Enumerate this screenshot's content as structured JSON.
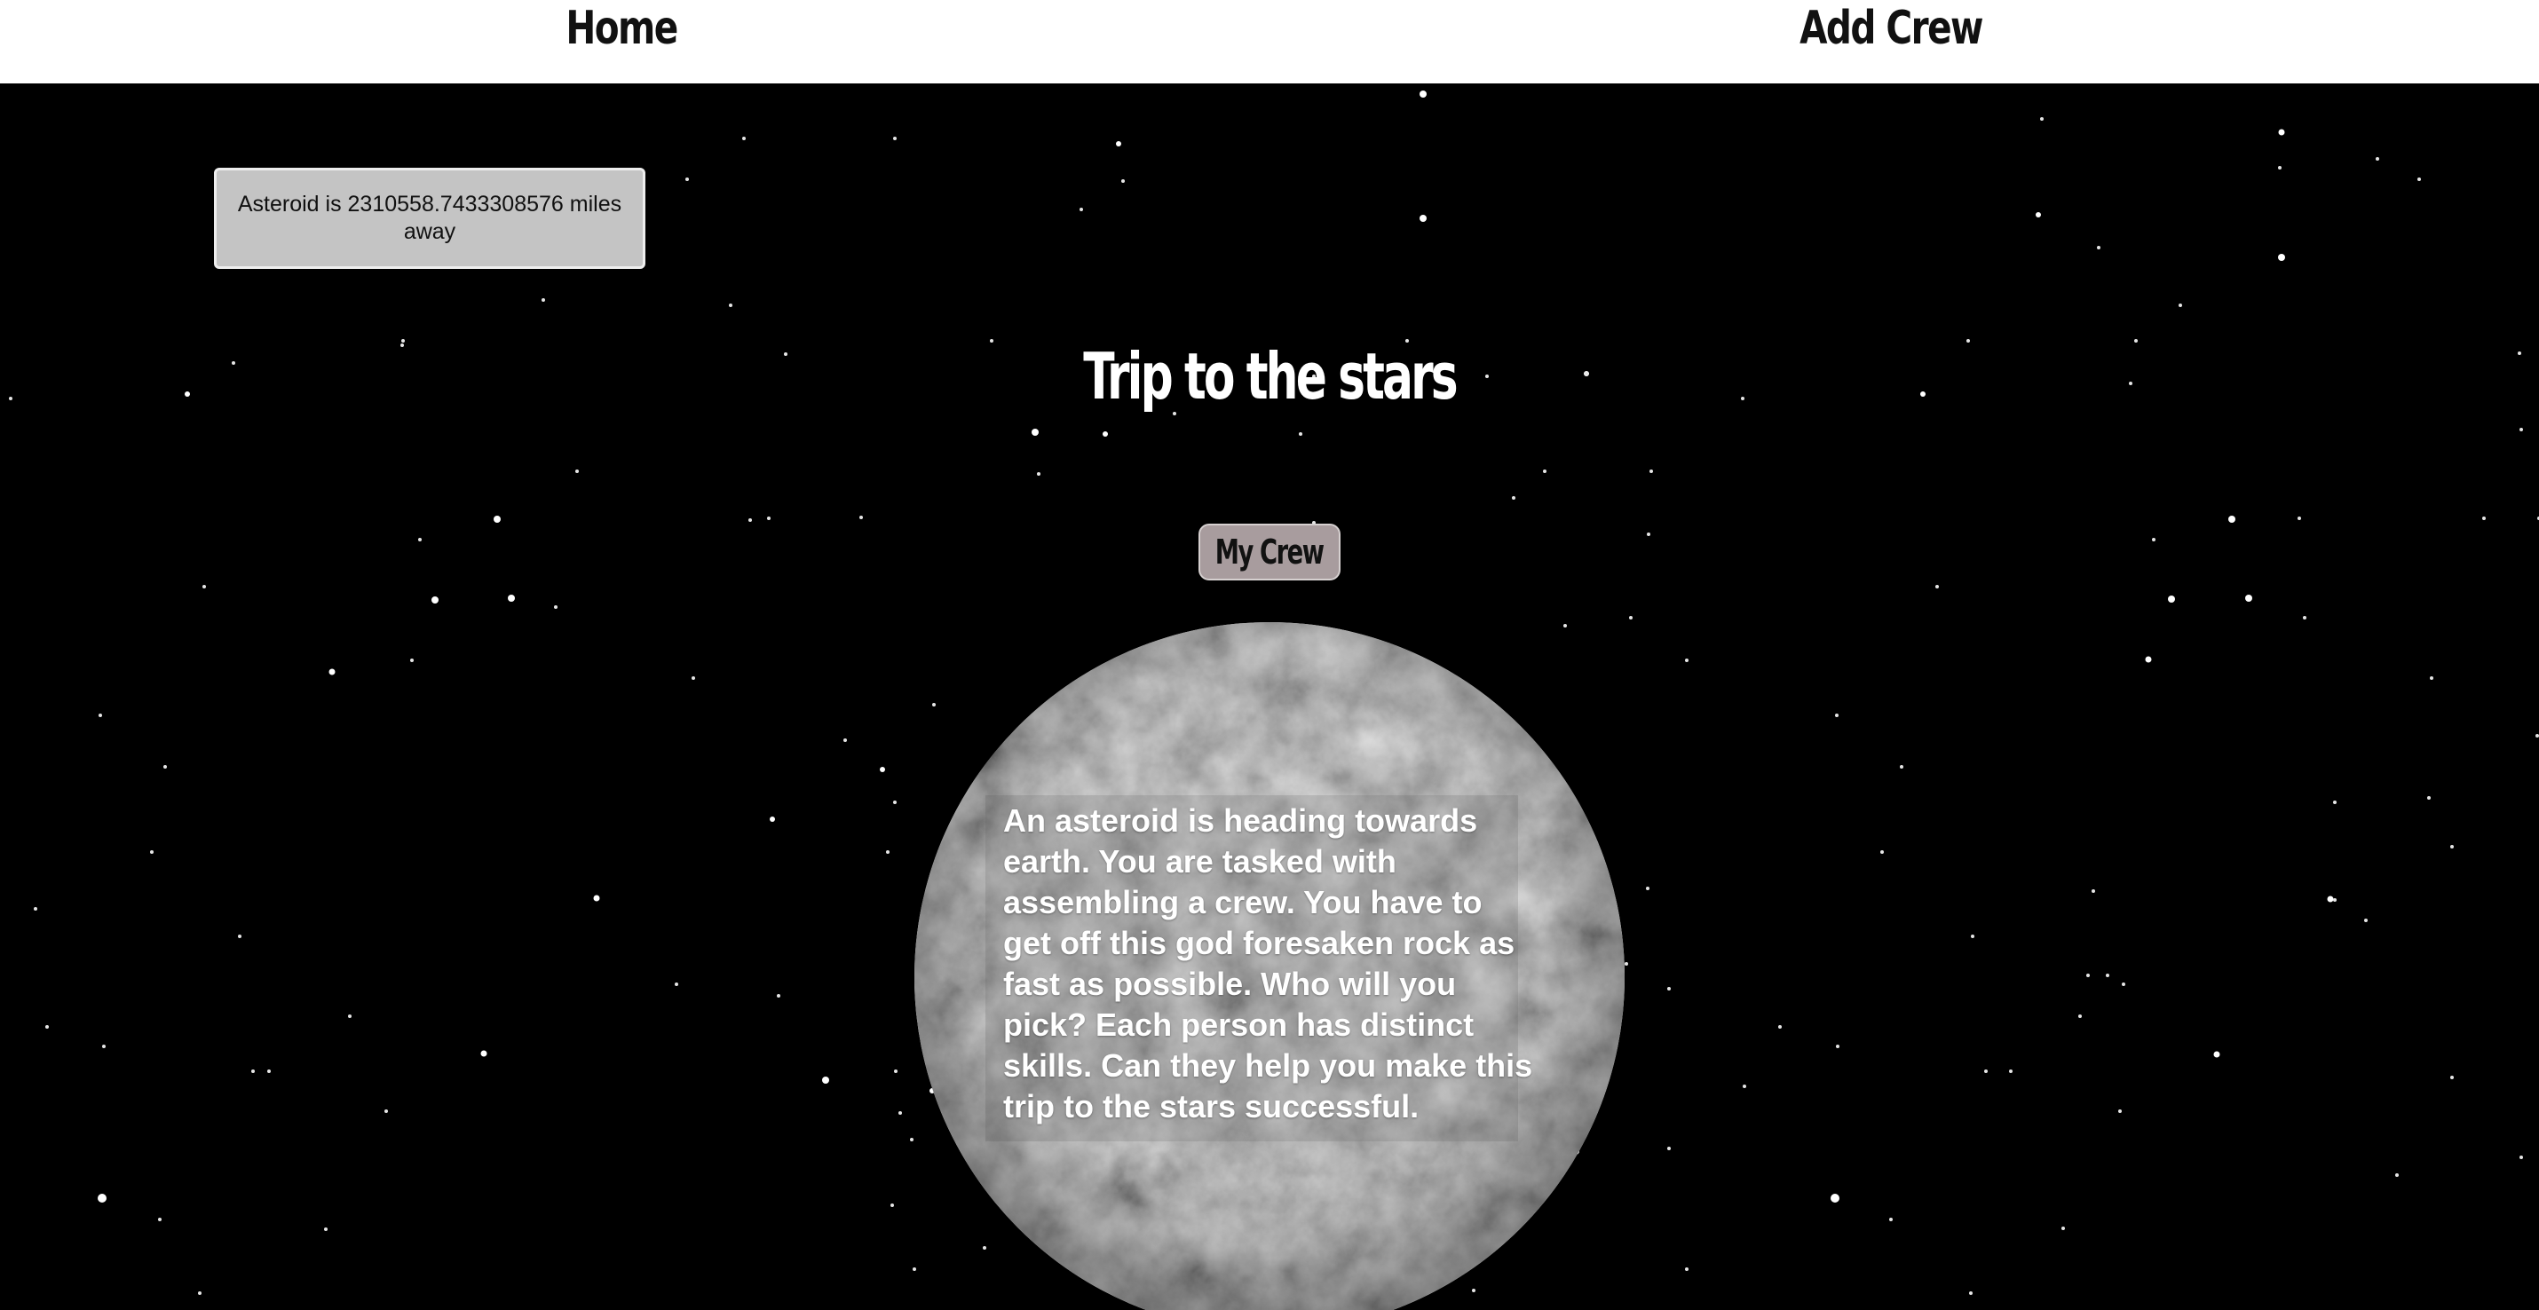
{
  "nav": {
    "home_label": "Home",
    "add_crew_label": "Add Crew"
  },
  "distance": {
    "text": "Asteroid is 2310558.7433308576 miles away"
  },
  "page": {
    "title": "Trip to the stars"
  },
  "crew_button": {
    "label": "My Crew"
  },
  "story": {
    "text": "An asteroid is heading towards earth. You are tasked with assembling a crew. You have to get off this god foresaken rock as fast as possible. Who will you pick? Each person has distinct skills. Can they help you make this trip to the stars successful."
  },
  "colors": {
    "nav_background": "#ffffff",
    "space_background": "#000000",
    "distance_box": "#c4c4c4",
    "crew_button": "#a89c9e",
    "asteroid": "#8a8a8a"
  }
}
